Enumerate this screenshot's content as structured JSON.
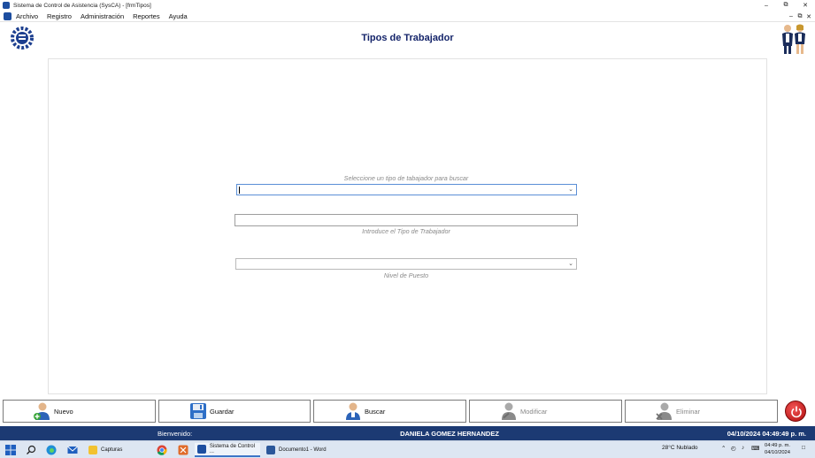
{
  "window": {
    "title": "Sistema de Control de Asistencia (SysCA) - [frmTipos]"
  },
  "menu": {
    "items": [
      "Archivo",
      "Registro",
      "Administración",
      "Reportes",
      "Ayuda"
    ]
  },
  "page": {
    "title": "Tipos de Trabajador"
  },
  "form": {
    "search_hint": "Seleccione un tipo de tabajador para buscar",
    "type_hint": "Introduce el Tipo de Trabajador",
    "level_hint": "Nivel de Puesto",
    "search_value": "",
    "type_value": "",
    "level_value": ""
  },
  "buttons": {
    "nuevo": "Nuevo",
    "guardar": "Guardar",
    "buscar": "Buscar",
    "modificar": "Modificar",
    "eliminar": "Eliminar"
  },
  "status": {
    "welcome": "Bienvenido:",
    "user": "DANIELA GOMEZ HERNANDEZ",
    "datetime": "04/10/2024 04:49:49 p. m."
  },
  "taskbar": {
    "apps": [
      "Capturas",
      "Sistema de Control ...",
      "Documento1 - Word"
    ],
    "weather": "28°C  Nublado",
    "time": "04:49 p. m.",
    "date": "04/10/2024"
  },
  "colors": {
    "accent": "#14246a",
    "status_bar": "#1c3a73",
    "power": "#d11a1a"
  }
}
